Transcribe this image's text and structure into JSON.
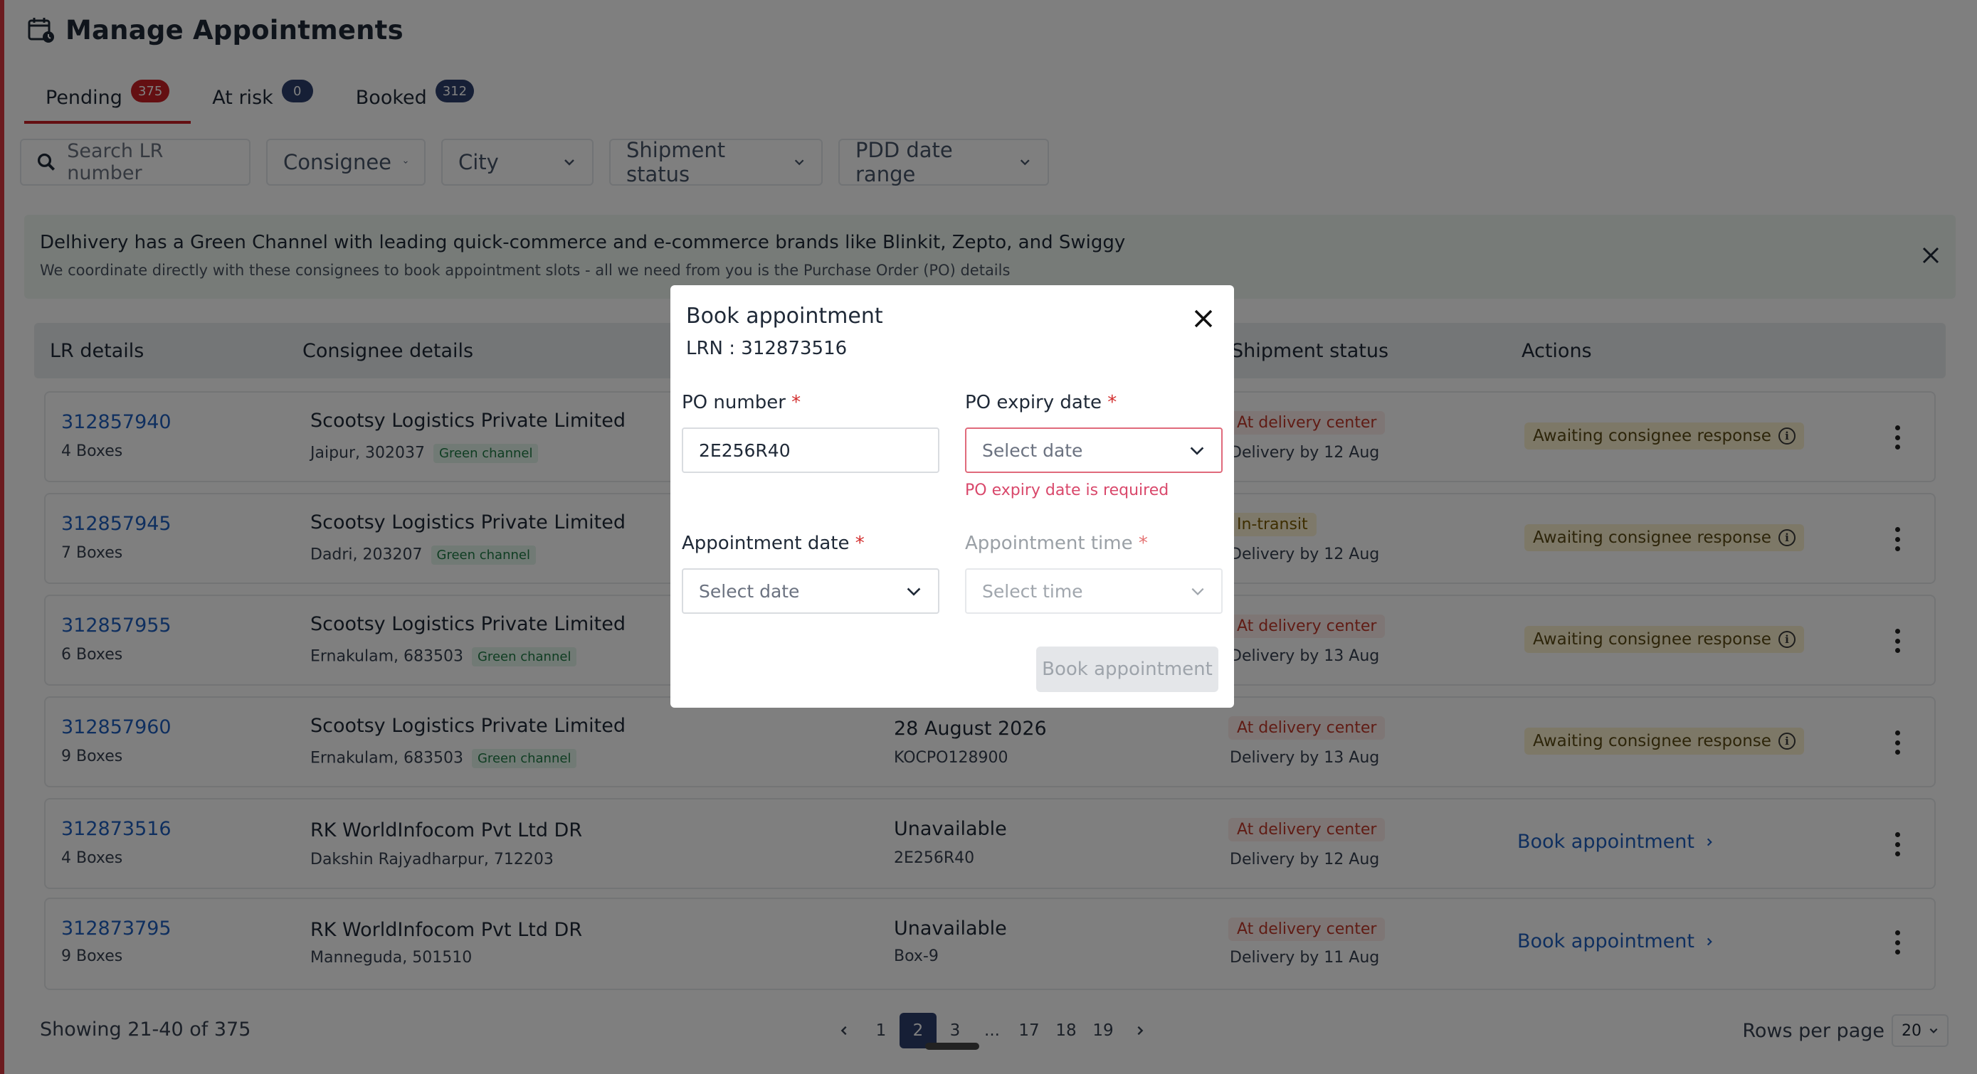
{
  "page": {
    "title": "Manage Appointments",
    "icon": "calendar-clock-icon",
    "accent_color": "#c81e24"
  },
  "tabs": [
    {
      "label": "Pending",
      "count": "375",
      "badge_color": "#c81e24",
      "active": true
    },
    {
      "label": "At risk",
      "count": "0",
      "badge_color": "#2c3e6d",
      "active": false
    },
    {
      "label": "Booked",
      "count": "312",
      "badge_color": "#2c3e6d",
      "active": false
    }
  ],
  "filters": {
    "search_placeholder": "Search LR number",
    "consignee": "Consignee",
    "city": "City",
    "shipment_status": "Shipment status",
    "pdd_date_range": "PDD date range"
  },
  "banner": {
    "title": "Delhivery has a Green Channel with leading quick-commerce and e-commerce brands like Blinkit, Zepto, and Swiggy",
    "subtitle": "We coordinate directly with these consignees to book appointment slots - all we need from you is the Purchase Order (PO) details"
  },
  "table": {
    "headers": {
      "lr_details": "LR details",
      "consignee_details": "Consignee details",
      "shipment_status": "Shipment status",
      "actions": "Actions"
    },
    "rows": [
      {
        "lr": "312857940",
        "boxes": "4 Boxes",
        "consignee": "Scootsy Logistics Private Limited",
        "location": "Jaipur, 302037",
        "tag": "Green channel",
        "po_title": "",
        "po_sub": "",
        "status": "At delivery center",
        "delivery": "Delivery by 12 Aug",
        "action": "Awaiting consignee response"
      },
      {
        "lr": "312857945",
        "boxes": "7 Boxes",
        "consignee": "Scootsy Logistics Private Limited",
        "location": "Dadri, 203207",
        "tag": "Green channel",
        "po_title": "",
        "po_sub": "",
        "status": "In-transit",
        "delivery": "Delivery by 12 Aug",
        "action": "Awaiting consignee response"
      },
      {
        "lr": "312857955",
        "boxes": "6 Boxes",
        "consignee": "Scootsy Logistics Private Limited",
        "location": "Ernakulam, 683503",
        "tag": "Green channel",
        "po_title": "",
        "po_sub": "",
        "status": "At delivery center",
        "delivery": "Delivery by 13 Aug",
        "action": "Awaiting consignee response"
      },
      {
        "lr": "312857960",
        "boxes": "9 Boxes",
        "consignee": "Scootsy Logistics Private Limited",
        "location": "Ernakulam, 683503",
        "tag": "Green channel",
        "po_title": "28 August 2026",
        "po_sub": "KOCPO128900",
        "status": "At delivery center",
        "delivery": "Delivery by 13 Aug",
        "action": "Awaiting consignee response"
      },
      {
        "lr": "312873516",
        "boxes": "4 Boxes",
        "consignee": "RK WorldInfocom Pvt Ltd DR",
        "location": "Dakshin Rajyadharpur, 712203",
        "tag": "",
        "po_title": "Unavailable",
        "po_sub": "2E256R40",
        "status": "At delivery center",
        "delivery": "Delivery by 12 Aug",
        "action": "Book appointment"
      },
      {
        "lr": "312873795",
        "boxes": "9 Boxes",
        "consignee": "RK WorldInfocom Pvt Ltd DR",
        "location": "Manneguda, 501510",
        "tag": "",
        "po_title": "Unavailable",
        "po_sub": "Box-9",
        "status": "At delivery center",
        "delivery": "Delivery by 11 Aug",
        "action": "Book appointment"
      }
    ]
  },
  "footer": {
    "showing": "Showing 21-40 of 375",
    "pages": [
      "1",
      "2",
      "3",
      "...",
      "17",
      "18",
      "19"
    ],
    "current_page": "2",
    "rows_per_page_label": "Rows per page",
    "rows_per_page_value": "20"
  },
  "modal": {
    "title": "Book appointment",
    "lrn": "LRN : 312873516",
    "po_number_label": "PO number",
    "po_number_value": "2E256R40",
    "po_expiry_label": "PO expiry date",
    "po_expiry_placeholder": "Select date",
    "po_expiry_error": "PO expiry date is required",
    "appointment_date_label": "Appointment date",
    "appointment_date_placeholder": "Select date",
    "appointment_time_label": "Appointment time",
    "appointment_time_placeholder": "Select time",
    "required_mark": "*",
    "submit_label": "Book appointment"
  }
}
